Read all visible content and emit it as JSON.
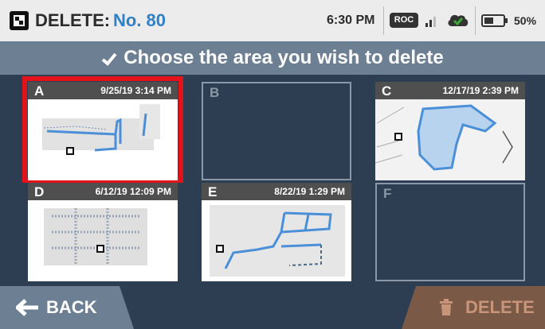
{
  "status_bar": {
    "title_prefix": "DELETE:",
    "title_number": "No. 80",
    "time": "6:30 PM",
    "roc_badge": "ROC",
    "battery_percent": "50%",
    "icons": [
      "app-logo-icon",
      "signal-icon",
      "cloud-check-icon",
      "battery-icon"
    ]
  },
  "header": {
    "title": "Choose the area you wish to delete",
    "icon": "checkmark-icon"
  },
  "areas": [
    {
      "letter": "A",
      "timestamp": "9/25/19 3:14 PM",
      "has_map": true,
      "selected": true
    },
    {
      "letter": "B",
      "timestamp": "",
      "has_map": false,
      "selected": false
    },
    {
      "letter": "C",
      "timestamp": "12/17/19 2:39 PM",
      "has_map": true,
      "selected": false
    },
    {
      "letter": "D",
      "timestamp": "6/12/19 12:09 PM",
      "has_map": true,
      "selected": false
    },
    {
      "letter": "E",
      "timestamp": "8/22/19 1:29 PM",
      "has_map": true,
      "selected": false
    },
    {
      "letter": "F",
      "timestamp": "",
      "has_map": false,
      "selected": false
    }
  ],
  "footer": {
    "back_label": "BACK",
    "delete_label": "DELETE"
  },
  "colors": {
    "accent_blue": "#2f80c6",
    "selection_red": "#e3121b",
    "delete_bg": "#7a5a46",
    "back_bg": "#6d7f93"
  }
}
